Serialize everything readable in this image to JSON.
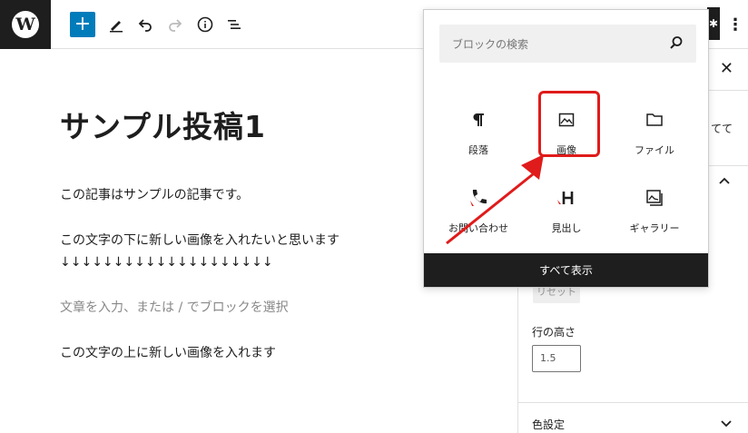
{
  "toolbar": {
    "logo_letter": "W",
    "add_symbol": "+",
    "more_symbol": "⋮",
    "settings_edge_symbol": "✱"
  },
  "editor": {
    "title": "サンプル投稿1",
    "paragraphs": [
      "この記事はサンプルの記事です。",
      "この文字の下に新しい画像を入れたいと思います",
      "↓↓↓↓↓↓↓↓↓↓↓↓↓↓↓↓↓↓↓↓",
      "文章を入力、または / でブロックを選択",
      "この文字の上に新しい画像を入れます"
    ],
    "inline_add_symbol": "+"
  },
  "sidebar": {
    "close_symbol": "✕",
    "partial_text": "てて",
    "reset_label": "リセット",
    "line_height_label": "行の高さ",
    "line_height_value": "1.5",
    "color_settings_label": "色設定"
  },
  "inserter": {
    "search_placeholder": "ブロックの検索",
    "blocks": [
      {
        "label": "段落",
        "icon": "paragraph-icon"
      },
      {
        "label": "画像",
        "icon": "image-icon"
      },
      {
        "label": "ファイル",
        "icon": "folder-icon"
      },
      {
        "label": "お問い合わせ",
        "icon": "phone-icon"
      },
      {
        "label": "見出し",
        "icon": "heading-icon"
      },
      {
        "label": "ギャラリー",
        "icon": "gallery-icon"
      }
    ],
    "show_all_label": "すべて表示"
  },
  "colors": {
    "accent": "#007cba",
    "highlight": "#e01b1b",
    "dark": "#1e1e1e"
  }
}
